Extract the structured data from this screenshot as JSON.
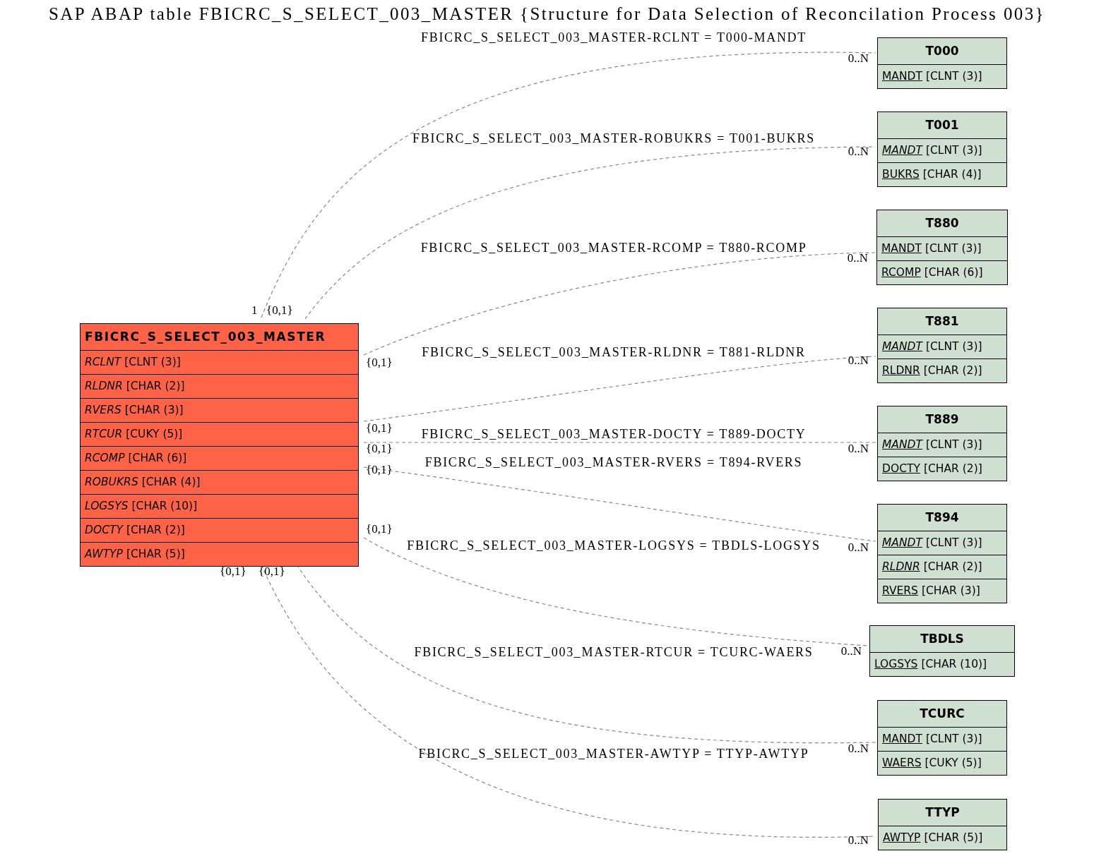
{
  "title": "SAP ABAP table FBICRC_S_SELECT_003_MASTER {Structure for Data Selection of Reconcilation Process 003}",
  "main_table": {
    "name": "FBICRC_S_SELECT_003_MASTER",
    "fields": [
      {
        "name": "RCLNT",
        "type": "[CLNT (3)]",
        "key": false,
        "italic": true
      },
      {
        "name": "RLDNR",
        "type": "[CHAR (2)]",
        "key": false,
        "italic": true
      },
      {
        "name": "RVERS",
        "type": "[CHAR (3)]",
        "key": false,
        "italic": true
      },
      {
        "name": "RTCUR",
        "type": "[CUKY (5)]",
        "key": false,
        "italic": true
      },
      {
        "name": "RCOMP",
        "type": "[CHAR (6)]",
        "key": false,
        "italic": true
      },
      {
        "name": "ROBUKRS",
        "type": "[CHAR (4)]",
        "key": false,
        "italic": true
      },
      {
        "name": "LOGSYS",
        "type": "[CHAR (10)]",
        "key": false,
        "italic": true
      },
      {
        "name": "DOCTY",
        "type": "[CHAR (2)]",
        "key": false,
        "italic": true
      },
      {
        "name": "AWTYP",
        "type": "[CHAR (5)]",
        "key": false,
        "italic": true
      }
    ]
  },
  "tables": [
    {
      "name": "T000",
      "fields": [
        {
          "name": "MANDT",
          "type": "[CLNT (3)]",
          "key": true,
          "italic": false
        }
      ]
    },
    {
      "name": "T001",
      "fields": [
        {
          "name": "MANDT",
          "type": "[CLNT (3)]",
          "key": true,
          "italic": true
        },
        {
          "name": "BUKRS",
          "type": "[CHAR (4)]",
          "key": true,
          "italic": false
        }
      ]
    },
    {
      "name": "T880",
      "fields": [
        {
          "name": "MANDT",
          "type": "[CLNT (3)]",
          "key": true,
          "italic": false
        },
        {
          "name": "RCOMP",
          "type": "[CHAR (6)]",
          "key": true,
          "italic": false
        }
      ]
    },
    {
      "name": "T881",
      "fields": [
        {
          "name": "MANDT",
          "type": "[CLNT (3)]",
          "key": true,
          "italic": true
        },
        {
          "name": "RLDNR",
          "type": "[CHAR (2)]",
          "key": true,
          "italic": false
        }
      ]
    },
    {
      "name": "T889",
      "fields": [
        {
          "name": "MANDT",
          "type": "[CLNT (3)]",
          "key": true,
          "italic": true
        },
        {
          "name": "DOCTY",
          "type": "[CHAR (2)]",
          "key": true,
          "italic": false
        }
      ]
    },
    {
      "name": "T894",
      "fields": [
        {
          "name": "MANDT",
          "type": "[CLNT (3)]",
          "key": true,
          "italic": true
        },
        {
          "name": "RLDNR",
          "type": "[CHAR (2)]",
          "key": true,
          "italic": true
        },
        {
          "name": "RVERS",
          "type": "[CHAR (3)]",
          "key": true,
          "italic": false
        }
      ]
    },
    {
      "name": "TBDLS",
      "fields": [
        {
          "name": "LOGSYS",
          "type": "[CHAR (10)]",
          "key": true,
          "italic": false
        }
      ]
    },
    {
      "name": "TCURC",
      "fields": [
        {
          "name": "MANDT",
          "type": "[CLNT (3)]",
          "key": true,
          "italic": false
        },
        {
          "name": "WAERS",
          "type": "[CUKY (5)]",
          "key": true,
          "italic": false
        }
      ]
    },
    {
      "name": "TTYP",
      "fields": [
        {
          "name": "AWTYP",
          "type": "[CHAR (5)]",
          "key": true,
          "italic": false
        }
      ]
    }
  ],
  "relations": [
    {
      "label": "FBICRC_S_SELECT_003_MASTER-RCLNT = T000-MANDT",
      "source_card": "1",
      "target_card": "0..N"
    },
    {
      "label": "FBICRC_S_SELECT_003_MASTER-ROBUKRS = T001-BUKRS",
      "source_card": "{0,1}",
      "target_card": "0..N"
    },
    {
      "label": "FBICRC_S_SELECT_003_MASTER-RCOMP = T880-RCOMP",
      "source_card": "{0,1}",
      "target_card": "0..N"
    },
    {
      "label": "FBICRC_S_SELECT_003_MASTER-RLDNR = T881-RLDNR",
      "source_card": "{0,1}",
      "target_card": "0..N"
    },
    {
      "label": "FBICRC_S_SELECT_003_MASTER-DOCTY = T889-DOCTY",
      "source_card": "{0,1}",
      "target_card": "0..N"
    },
    {
      "label": "FBICRC_S_SELECT_003_MASTER-RVERS = T894-RVERS",
      "source_card": "{0,1}",
      "target_card": "0..N"
    },
    {
      "label": "FBICRC_S_SELECT_003_MASTER-LOGSYS = TBDLS-LOGSYS",
      "source_card": "{0,1}",
      "target_card": "0..N"
    },
    {
      "label": "FBICRC_S_SELECT_003_MASTER-RTCUR = TCURC-WAERS",
      "source_card": "{0,1}",
      "target_card": "0..N"
    },
    {
      "label": "FBICRC_S_SELECT_003_MASTER-AWTYP = TTYP-AWTYP",
      "source_card": "{0,1}",
      "target_card": "0..N"
    }
  ]
}
